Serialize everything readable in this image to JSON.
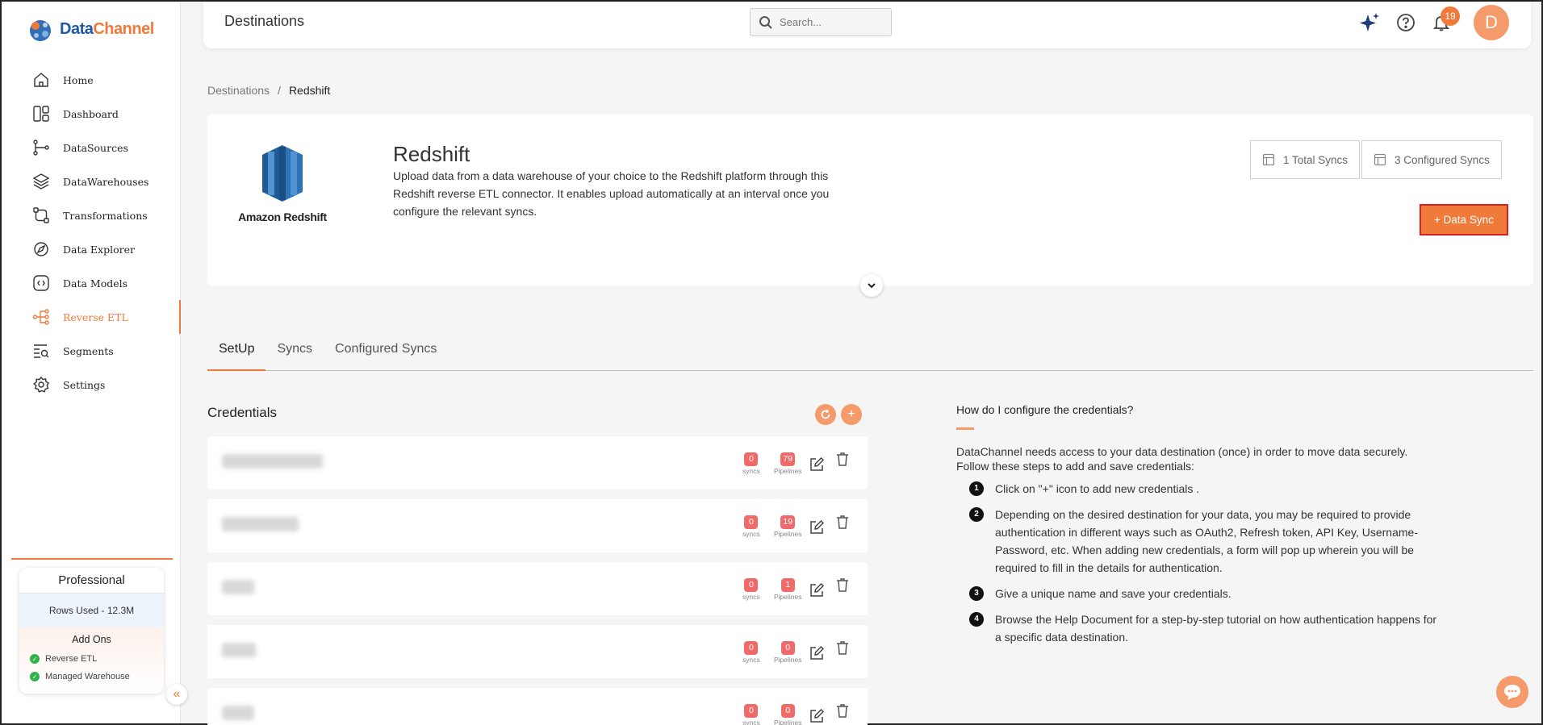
{
  "brand": {
    "name_part1": "Data",
    "name_part2": "Channel"
  },
  "sidebar": {
    "items": [
      {
        "label": "Home",
        "icon": "home-icon"
      },
      {
        "label": "Dashboard",
        "icon": "dashboard-icon"
      },
      {
        "label": "DataSources",
        "icon": "datasources-icon"
      },
      {
        "label": "DataWarehouses",
        "icon": "datawarehouses-icon"
      },
      {
        "label": "Transformations",
        "icon": "transformations-icon"
      },
      {
        "label": "Data Explorer",
        "icon": "data-explorer-icon"
      },
      {
        "label": "Data Models",
        "icon": "data-models-icon"
      },
      {
        "label": "Reverse ETL",
        "icon": "reverse-etl-icon",
        "active": true
      },
      {
        "label": "Segments",
        "icon": "segments-icon"
      },
      {
        "label": "Settings",
        "icon": "settings-icon"
      }
    ],
    "plan": {
      "title": "Professional",
      "rows_used": "Rows Used - 12.3M",
      "addons_title": "Add Ons",
      "addons": [
        "Reverse ETL",
        "Managed Warehouse"
      ]
    }
  },
  "header": {
    "title": "Destinations",
    "search_placeholder": "Search...",
    "notification_count": "19",
    "avatar_initial": "D"
  },
  "breadcrumb": {
    "parent": "Destinations",
    "separator": "/",
    "current": "Redshift"
  },
  "destination": {
    "logo_text": "Amazon Redshift",
    "title": "Redshift",
    "description": "Upload data from a data warehouse of your choice to the Redshift platform through this Redshift reverse ETL connector. It enables upload automatically at an interval once you configure the relevant syncs.",
    "total_syncs": "1 Total Syncs",
    "configured_syncs": "3 Configured Syncs",
    "data_sync_button": "+ Data Sync"
  },
  "tabs": [
    "SetUp",
    "Syncs",
    "Configured Syncs"
  ],
  "credentials": {
    "title": "Credentials",
    "syncs_label": "syncs",
    "pipelines_label": "Pipelines",
    "rows": [
      {
        "syncs": "0",
        "pipelines": "79"
      },
      {
        "syncs": "0",
        "pipelines": "19"
      },
      {
        "syncs": "0",
        "pipelines": "1"
      },
      {
        "syncs": "0",
        "pipelines": "0"
      },
      {
        "syncs": "0",
        "pipelines": "0"
      }
    ]
  },
  "help": {
    "title": "How do I configure the credentials?",
    "intro": "DataChannel needs access to your data destination (once) in order to move data securely. Follow these steps to add and save credentials:",
    "steps": [
      "Click on \"+\" icon to add new credentials .",
      "Depending on the desired destination for your data, you may be required to provide authentication in different ways such as OAuth2, Refresh token, API Key, Username-Password, etc. When adding new credentials, a form will pop up wherein you will be required to fill in the details for authentication.",
      "Give a unique name and save your credentials.",
      "Browse the Help Document for a step-by-step tutorial on how authentication happens for a specific data destination."
    ]
  },
  "colors": {
    "accent": "#f07a3a",
    "badge_red": "#f06a6a",
    "brand_blue": "#1f5aa6"
  }
}
